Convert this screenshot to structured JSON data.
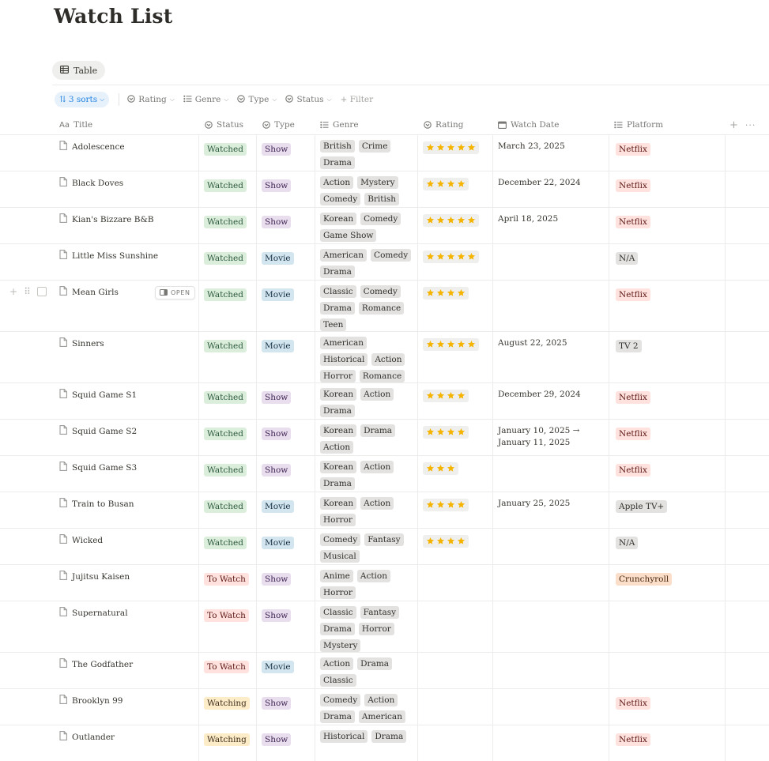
{
  "page_title": "Watch List",
  "view_tab": "Table",
  "toolbar": {
    "sorts": "3 sorts",
    "filters": [
      "Rating",
      "Genre",
      "Type",
      "Status"
    ],
    "add_filter": "+ Filter"
  },
  "columns": {
    "title": "Title",
    "status": "Status",
    "type": "Type",
    "genre": "Genre",
    "rating": "Rating",
    "watch_date": "Watch Date",
    "platform": "Platform"
  },
  "open_label": "OPEN",
  "colors": {
    "Watched": {
      "bg": "#dbeddb",
      "fg": "#2b593f"
    },
    "To Watch": {
      "bg": "#ffe2dd",
      "fg": "#5d1715"
    },
    "Watching": {
      "bg": "#fdecc8",
      "fg": "#402c1b"
    },
    "Show": {
      "bg": "#e8deee",
      "fg": "#412454"
    },
    "Movie": {
      "bg": "#d3e5ef",
      "fg": "#183347"
    },
    "genre": {
      "bg": "#e3e2e0",
      "fg": "#32302c"
    },
    "Netflix": {
      "bg": "#ffe2dd",
      "fg": "#5d1715"
    },
    "N/A": {
      "bg": "#e3e2e0",
      "fg": "#32302c"
    },
    "TV 2": {
      "bg": "#e3e2e0",
      "fg": "#32302c"
    },
    "Apple TV+": {
      "bg": "#e3e2e0",
      "fg": "#32302c"
    },
    "Crunchyroll": {
      "bg": "#fadec9",
      "fg": "#49290e"
    },
    "star": "#f5b400"
  },
  "rows": [
    {
      "title": "Adolescence",
      "status": "Watched",
      "type": "Show",
      "genres": [
        "British",
        "Crime",
        "Drama"
      ],
      "rating": 5,
      "date": "March 23, 2025",
      "platform": "Netflix"
    },
    {
      "title": "Black Doves",
      "status": "Watched",
      "type": "Show",
      "genres": [
        "Action",
        "Mystery",
        "Comedy",
        "British"
      ],
      "rating": 4,
      "date": "December 22, 2024",
      "platform": "Netflix"
    },
    {
      "title": "Kian's Bizzare B&B",
      "status": "Watched",
      "type": "Show",
      "genres": [
        "Korean",
        "Comedy",
        "Game Show"
      ],
      "rating": 5,
      "date": "April 18, 2025",
      "platform": "Netflix"
    },
    {
      "title": "Little Miss Sunshine",
      "status": "Watched",
      "type": "Movie",
      "genres": [
        "American",
        "Comedy",
        "Drama"
      ],
      "rating": 5,
      "date": "",
      "platform": "N/A"
    },
    {
      "title": "Mean Girls",
      "status": "Watched",
      "type": "Movie",
      "genres": [
        "Classic",
        "Comedy",
        "Drama",
        "Romance",
        "Teen"
      ],
      "rating": 4,
      "date": "",
      "platform": "Netflix",
      "hover": true
    },
    {
      "title": "Sinners",
      "status": "Watched",
      "type": "Movie",
      "genres": [
        "American",
        "Historical",
        "Action",
        "Horror",
        "Romance"
      ],
      "rating": 5,
      "date": "August 22, 2025",
      "platform": "TV 2"
    },
    {
      "title": "Squid Game S1",
      "status": "Watched",
      "type": "Show",
      "genres": [
        "Korean",
        "Action",
        "Drama"
      ],
      "rating": 4,
      "date": "December 29, 2024",
      "platform": "Netflix"
    },
    {
      "title": "Squid Game S2",
      "status": "Watched",
      "type": "Show",
      "genres": [
        "Korean",
        "Drama",
        "Action"
      ],
      "rating": 4,
      "date": "January 10, 2025 → January 11, 2025",
      "platform": "Netflix"
    },
    {
      "title": "Squid Game S3",
      "status": "Watched",
      "type": "Show",
      "genres": [
        "Korean",
        "Action",
        "Drama"
      ],
      "rating": 3,
      "date": "",
      "platform": "Netflix"
    },
    {
      "title": "Train to Busan",
      "status": "Watched",
      "type": "Movie",
      "genres": [
        "Korean",
        "Action",
        "Horror"
      ],
      "rating": 4,
      "date": "January 25, 2025",
      "platform": "Apple TV+"
    },
    {
      "title": "Wicked",
      "status": "Watched",
      "type": "Movie",
      "genres": [
        "Comedy",
        "Fantasy",
        "Musical"
      ],
      "rating": 4,
      "date": "",
      "platform": "N/A"
    },
    {
      "title": "Jujitsu Kaisen",
      "status": "To Watch",
      "type": "Show",
      "genres": [
        "Anime",
        "Action",
        "Horror"
      ],
      "rating": 0,
      "date": "",
      "platform": "Crunchyroll"
    },
    {
      "title": "Supernatural",
      "status": "To Watch",
      "type": "Show",
      "genres": [
        "Classic",
        "Fantasy",
        "Drama",
        "Horror",
        "Mystery"
      ],
      "rating": 0,
      "date": "",
      "platform": ""
    },
    {
      "title": "The Godfather",
      "status": "To Watch",
      "type": "Movie",
      "genres": [
        "Action",
        "Drama",
        "Classic"
      ],
      "rating": 0,
      "date": "",
      "platform": ""
    },
    {
      "title": "Brooklyn 99",
      "status": "Watching",
      "type": "Show",
      "genres": [
        "Comedy",
        "Action",
        "Drama",
        "American"
      ],
      "rating": 0,
      "date": "",
      "platform": "Netflix"
    },
    {
      "title": "Outlander",
      "status": "Watching",
      "type": "Show",
      "genres": [
        "Historical",
        "Drama"
      ],
      "rating": 0,
      "date": "",
      "platform": "Netflix"
    }
  ]
}
